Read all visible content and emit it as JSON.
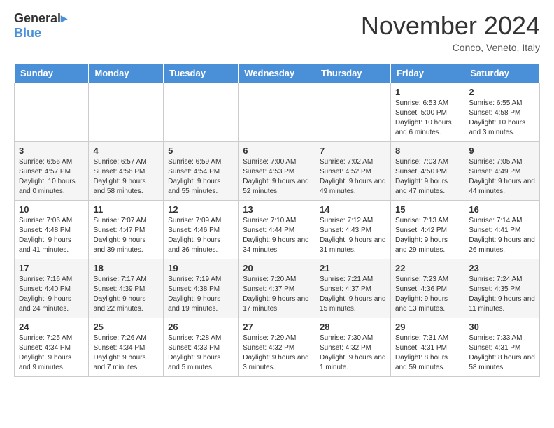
{
  "header": {
    "logo_line1": "General",
    "logo_line2": "Blue",
    "month": "November 2024",
    "location": "Conco, Veneto, Italy"
  },
  "days_of_week": [
    "Sunday",
    "Monday",
    "Tuesday",
    "Wednesday",
    "Thursday",
    "Friday",
    "Saturday"
  ],
  "weeks": [
    [
      {
        "day": "",
        "info": ""
      },
      {
        "day": "",
        "info": ""
      },
      {
        "day": "",
        "info": ""
      },
      {
        "day": "",
        "info": ""
      },
      {
        "day": "",
        "info": ""
      },
      {
        "day": "1",
        "info": "Sunrise: 6:53 AM\nSunset: 5:00 PM\nDaylight: 10 hours and 6 minutes."
      },
      {
        "day": "2",
        "info": "Sunrise: 6:55 AM\nSunset: 4:58 PM\nDaylight: 10 hours and 3 minutes."
      }
    ],
    [
      {
        "day": "3",
        "info": "Sunrise: 6:56 AM\nSunset: 4:57 PM\nDaylight: 10 hours and 0 minutes."
      },
      {
        "day": "4",
        "info": "Sunrise: 6:57 AM\nSunset: 4:56 PM\nDaylight: 9 hours and 58 minutes."
      },
      {
        "day": "5",
        "info": "Sunrise: 6:59 AM\nSunset: 4:54 PM\nDaylight: 9 hours and 55 minutes."
      },
      {
        "day": "6",
        "info": "Sunrise: 7:00 AM\nSunset: 4:53 PM\nDaylight: 9 hours and 52 minutes."
      },
      {
        "day": "7",
        "info": "Sunrise: 7:02 AM\nSunset: 4:52 PM\nDaylight: 9 hours and 49 minutes."
      },
      {
        "day": "8",
        "info": "Sunrise: 7:03 AM\nSunset: 4:50 PM\nDaylight: 9 hours and 47 minutes."
      },
      {
        "day": "9",
        "info": "Sunrise: 7:05 AM\nSunset: 4:49 PM\nDaylight: 9 hours and 44 minutes."
      }
    ],
    [
      {
        "day": "10",
        "info": "Sunrise: 7:06 AM\nSunset: 4:48 PM\nDaylight: 9 hours and 41 minutes."
      },
      {
        "day": "11",
        "info": "Sunrise: 7:07 AM\nSunset: 4:47 PM\nDaylight: 9 hours and 39 minutes."
      },
      {
        "day": "12",
        "info": "Sunrise: 7:09 AM\nSunset: 4:46 PM\nDaylight: 9 hours and 36 minutes."
      },
      {
        "day": "13",
        "info": "Sunrise: 7:10 AM\nSunset: 4:44 PM\nDaylight: 9 hours and 34 minutes."
      },
      {
        "day": "14",
        "info": "Sunrise: 7:12 AM\nSunset: 4:43 PM\nDaylight: 9 hours and 31 minutes."
      },
      {
        "day": "15",
        "info": "Sunrise: 7:13 AM\nSunset: 4:42 PM\nDaylight: 9 hours and 29 minutes."
      },
      {
        "day": "16",
        "info": "Sunrise: 7:14 AM\nSunset: 4:41 PM\nDaylight: 9 hours and 26 minutes."
      }
    ],
    [
      {
        "day": "17",
        "info": "Sunrise: 7:16 AM\nSunset: 4:40 PM\nDaylight: 9 hours and 24 minutes."
      },
      {
        "day": "18",
        "info": "Sunrise: 7:17 AM\nSunset: 4:39 PM\nDaylight: 9 hours and 22 minutes."
      },
      {
        "day": "19",
        "info": "Sunrise: 7:19 AM\nSunset: 4:38 PM\nDaylight: 9 hours and 19 minutes."
      },
      {
        "day": "20",
        "info": "Sunrise: 7:20 AM\nSunset: 4:37 PM\nDaylight: 9 hours and 17 minutes."
      },
      {
        "day": "21",
        "info": "Sunrise: 7:21 AM\nSunset: 4:37 PM\nDaylight: 9 hours and 15 minutes."
      },
      {
        "day": "22",
        "info": "Sunrise: 7:23 AM\nSunset: 4:36 PM\nDaylight: 9 hours and 13 minutes."
      },
      {
        "day": "23",
        "info": "Sunrise: 7:24 AM\nSunset: 4:35 PM\nDaylight: 9 hours and 11 minutes."
      }
    ],
    [
      {
        "day": "24",
        "info": "Sunrise: 7:25 AM\nSunset: 4:34 PM\nDaylight: 9 hours and 9 minutes."
      },
      {
        "day": "25",
        "info": "Sunrise: 7:26 AM\nSunset: 4:34 PM\nDaylight: 9 hours and 7 minutes."
      },
      {
        "day": "26",
        "info": "Sunrise: 7:28 AM\nSunset: 4:33 PM\nDaylight: 9 hours and 5 minutes."
      },
      {
        "day": "27",
        "info": "Sunrise: 7:29 AM\nSunset: 4:32 PM\nDaylight: 9 hours and 3 minutes."
      },
      {
        "day": "28",
        "info": "Sunrise: 7:30 AM\nSunset: 4:32 PM\nDaylight: 9 hours and 1 minute."
      },
      {
        "day": "29",
        "info": "Sunrise: 7:31 AM\nSunset: 4:31 PM\nDaylight: 8 hours and 59 minutes."
      },
      {
        "day": "30",
        "info": "Sunrise: 7:33 AM\nSunset: 4:31 PM\nDaylight: 8 hours and 58 minutes."
      }
    ]
  ]
}
